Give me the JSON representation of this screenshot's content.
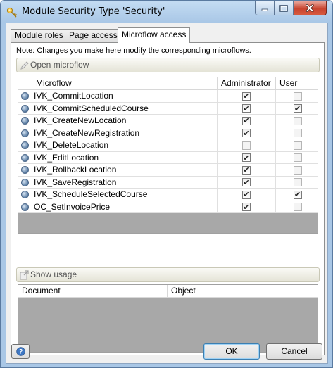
{
  "window": {
    "title": "Module Security Type 'Security'"
  },
  "tabs": [
    {
      "label": "Module roles",
      "active": false
    },
    {
      "label": "Page access",
      "active": false
    },
    {
      "label": "Microflow access",
      "active": true
    }
  ],
  "note": "Note: Changes you make here modify the corresponding microflows.",
  "open_microflow": {
    "label": "Open microflow",
    "enabled": false
  },
  "microflow_table": {
    "columns": [
      "Microflow",
      "Administrator",
      "User"
    ],
    "rows": [
      {
        "name": "IVK_CommitLocation",
        "administrator": true,
        "user": false
      },
      {
        "name": "IVK_CommitScheduledCourse",
        "administrator": true,
        "user": true
      },
      {
        "name": "IVK_CreateNewLocation",
        "administrator": true,
        "user": false
      },
      {
        "name": "IVK_CreateNewRegistration",
        "administrator": true,
        "user": false
      },
      {
        "name": "IVK_DeleteLocation",
        "administrator": false,
        "user": false
      },
      {
        "name": "IVK_EditLocation",
        "administrator": true,
        "user": false
      },
      {
        "name": "IVK_RollbackLocation",
        "administrator": true,
        "user": false
      },
      {
        "name": "IVK_SaveRegistration",
        "administrator": true,
        "user": false
      },
      {
        "name": "IVK_ScheduleSelectedCourse",
        "administrator": true,
        "user": true
      },
      {
        "name": "OC_SetInvoicePrice",
        "administrator": true,
        "user": false
      }
    ]
  },
  "show_usage": {
    "label": "Show usage",
    "enabled": false
  },
  "usage_table": {
    "columns": [
      "Document",
      "Object"
    ]
  },
  "footer": {
    "ok_label": "OK",
    "cancel_label": "Cancel"
  },
  "colors": {
    "frame": "#a9c7e6",
    "client": "#f0f0f0",
    "grid_empty": "#a8a8a8",
    "close_button": "#c8442f"
  }
}
